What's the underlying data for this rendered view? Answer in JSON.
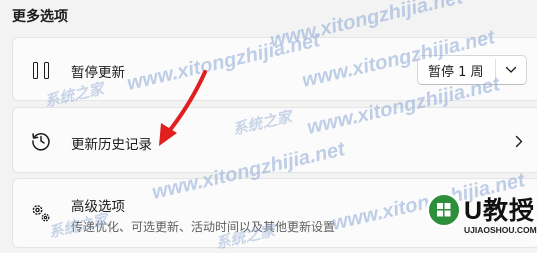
{
  "section": {
    "title": "更多选项"
  },
  "pause_updates": {
    "icon": "pause-icon",
    "label": "暂停更新",
    "dropdown_value": "暂停 1 周",
    "dropdown_icon": "chevron-down-icon"
  },
  "update_history": {
    "icon": "history-icon",
    "label": "更新历史记录",
    "chevron_icon": "chevron-right-icon"
  },
  "advanced_options": {
    "icon": "gear-icon",
    "label": "高级选项",
    "description": "传递优化、可选更新、活动时间以及其他更新设置"
  },
  "watermark": {
    "url_text": "www.xitongzhijia.net",
    "cn_text": "系统之家"
  },
  "logo": {
    "name": "U教授",
    "url": "UJIAOSHOU.COM"
  },
  "colors": {
    "accent_arrow": "#e02020",
    "logo_green": "#2d8f3a"
  }
}
